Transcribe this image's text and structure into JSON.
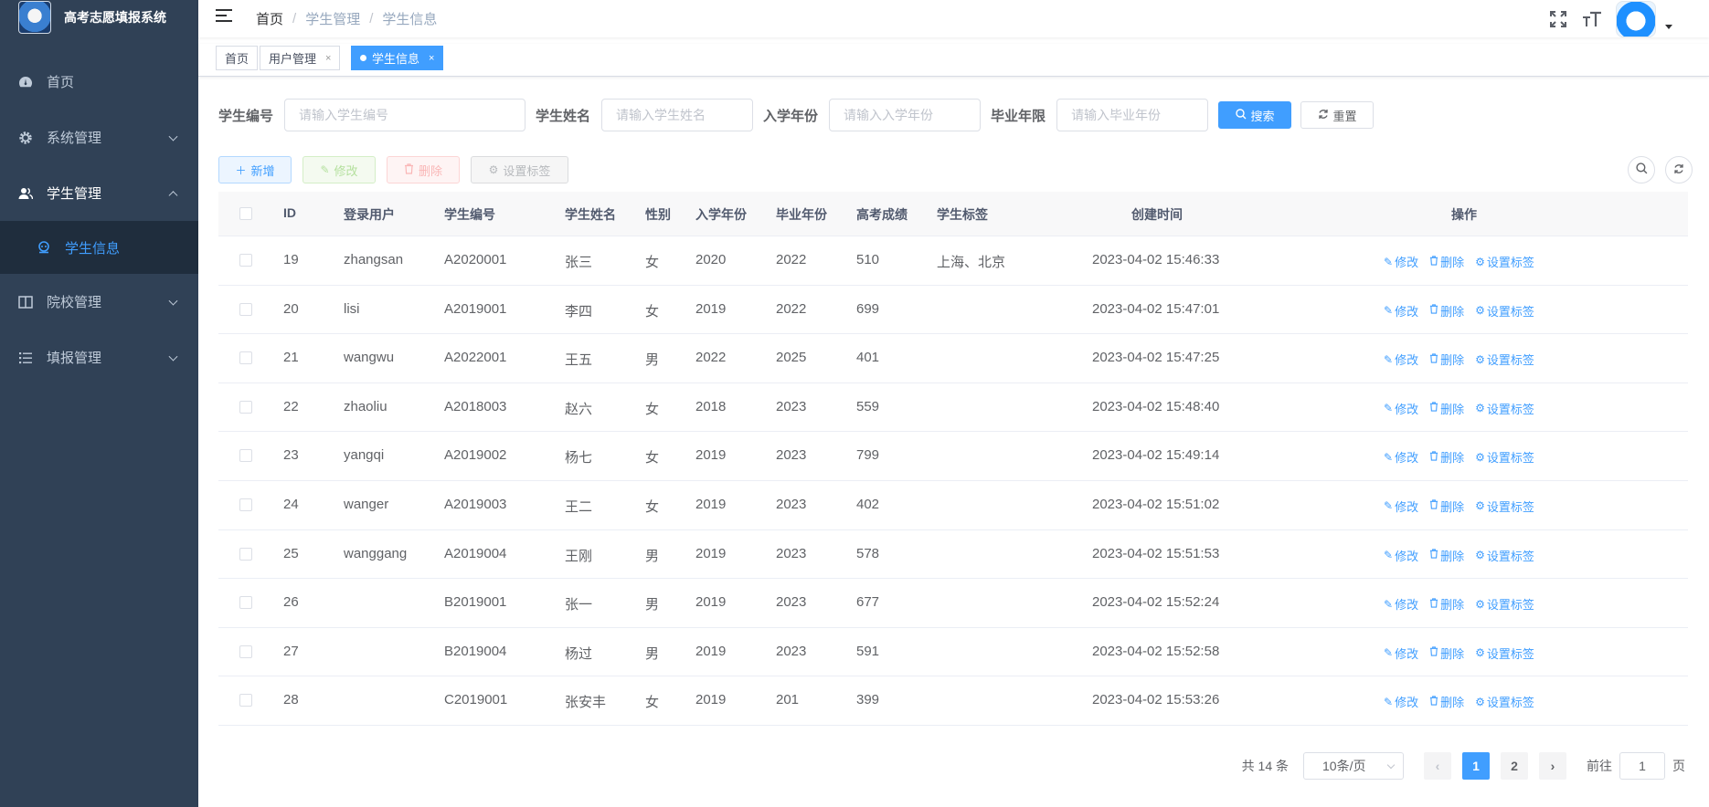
{
  "app": {
    "title": "高考志愿填报系统"
  },
  "sidebar": {
    "items": [
      {
        "label": "首页",
        "icon": "dashboard-icon"
      },
      {
        "label": "系统管理",
        "icon": "gear-icon"
      },
      {
        "label": "学生管理",
        "icon": "user-icon"
      },
      {
        "label": "院校管理",
        "icon": "book-icon"
      },
      {
        "label": "填报管理",
        "icon": "list-icon"
      }
    ],
    "active_sub": {
      "label": "学生信息",
      "icon": "student-icon"
    }
  },
  "breadcrumb": [
    "首页",
    "学生管理",
    "学生信息"
  ],
  "tags": [
    {
      "label": "首页"
    },
    {
      "label": "用户管理",
      "close": "×"
    },
    {
      "label": "学生信息",
      "close": "×"
    }
  ],
  "search": {
    "fields": [
      {
        "label": "学生编号",
        "placeholder": "请输入学生编号"
      },
      {
        "label": "学生姓名",
        "placeholder": "请输入学生姓名"
      },
      {
        "label": "入学年份",
        "placeholder": "请输入入学年份"
      },
      {
        "label": "毕业年限",
        "placeholder": "请输入毕业年份"
      }
    ],
    "search_label": "搜索",
    "reset_label": "重置"
  },
  "toolbar": {
    "add_label": "新增",
    "edit_label": "修改",
    "delete_label": "删除",
    "tag_label": "设置标签"
  },
  "table": {
    "headers": [
      "ID",
      "登录用户",
      "学生编号",
      "学生姓名",
      "性别",
      "入学年份",
      "毕业年份",
      "高考成绩",
      "学生标签",
      "创建时间",
      "操作"
    ],
    "rows": [
      [
        "19",
        "zhangsan",
        "A2020001",
        "张三",
        "女",
        "2020",
        "2022",
        "510",
        "上海、北京",
        "2023-04-02 15:46:33"
      ],
      [
        "20",
        "lisi",
        "A2019001",
        "李四",
        "女",
        "2019",
        "2022",
        "699",
        "",
        "2023-04-02 15:47:01"
      ],
      [
        "21",
        "wangwu",
        "A2022001",
        "王五",
        "男",
        "2022",
        "2025",
        "401",
        "",
        "2023-04-02 15:47:25"
      ],
      [
        "22",
        "zhaoliu",
        "A2018003",
        "赵六",
        "女",
        "2018",
        "2023",
        "559",
        "",
        "2023-04-02 15:48:40"
      ],
      [
        "23",
        "yangqi",
        "A2019002",
        "杨七",
        "女",
        "2019",
        "2023",
        "799",
        "",
        "2023-04-02 15:49:14"
      ],
      [
        "24",
        "wanger",
        "A2019003",
        "王二",
        "女",
        "2019",
        "2023",
        "402",
        "",
        "2023-04-02 15:51:02"
      ],
      [
        "25",
        "wanggang",
        "A2019004",
        "王刚",
        "男",
        "2019",
        "2023",
        "578",
        "",
        "2023-04-02 15:51:53"
      ],
      [
        "26",
        "",
        "B2019001",
        "张一",
        "男",
        "2019",
        "2023",
        "677",
        "",
        "2023-04-02 15:52:24"
      ],
      [
        "27",
        "",
        "B2019004",
        "杨过",
        "男",
        "2019",
        "2023",
        "591",
        "",
        "2023-04-02 15:52:58"
      ],
      [
        "28",
        "",
        "C2019001",
        "张安丰",
        "女",
        "2019",
        "201",
        "399",
        "",
        "2023-04-02 15:53:26"
      ]
    ],
    "actions": {
      "edit": "修改",
      "delete": "删除",
      "tag": "设置标签"
    }
  },
  "pagination": {
    "total": "共 14 条",
    "page_size": "10条/页",
    "pages": [
      "1",
      "2"
    ],
    "goto_prefix": "前往",
    "goto_value": "1",
    "goto_suffix": "页"
  },
  "colors": {
    "sidebar_bg": "#304156",
    "primary": "#409eff"
  }
}
